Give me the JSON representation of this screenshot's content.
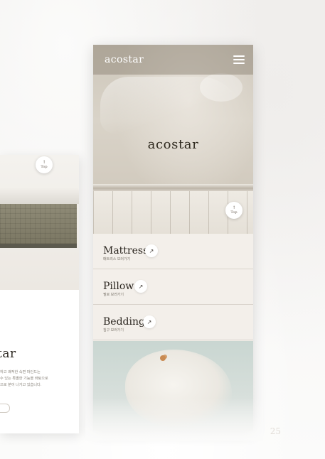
{
  "page": {
    "page_number": "25"
  },
  "left_phone": {
    "top_button": {
      "arrow": "↑",
      "label": "Top"
    },
    "brand": "tar",
    "description": "하고 쾌적한 숙면 마인드는\n수 있는 특별한 기능을 바탕으로\n으로 분어 나가고 있습니다."
  },
  "main_phone": {
    "header": {
      "logo": "acostar"
    },
    "hero": {
      "logo": "acostar"
    },
    "top_button": {
      "arrow": "↑",
      "label": "Top"
    },
    "menu": [
      {
        "title": "Mattress",
        "subtitle": "매트리스 보러가기",
        "arrow": "↗"
      },
      {
        "title": "Pillow",
        "subtitle": "필로 보러가기",
        "arrow": "↗"
      },
      {
        "title": "Bedding",
        "subtitle": "침구 보러가기",
        "arrow": "↗"
      }
    ]
  }
}
